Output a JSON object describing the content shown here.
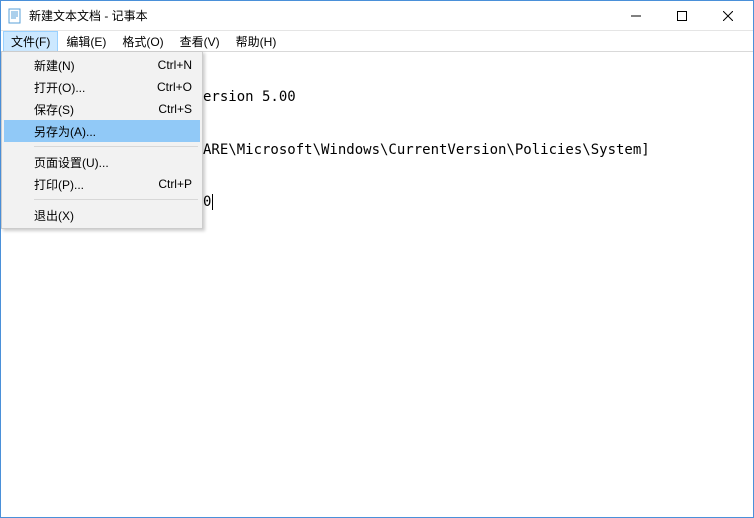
{
  "window": {
    "title": "新建文本文档 - 记事本"
  },
  "menubar": {
    "file": "文件(F)",
    "edit": "编辑(E)",
    "format": "格式(O)",
    "view": "查看(V)",
    "help": "帮助(H)"
  },
  "file_menu": {
    "new": {
      "label": "新建(N)",
      "shortcut": "Ctrl+N"
    },
    "open": {
      "label": "打开(O)...",
      "shortcut": "Ctrl+O"
    },
    "save": {
      "label": "保存(S)",
      "shortcut": "Ctrl+S"
    },
    "saveas": {
      "label": "另存为(A)...",
      "shortcut": ""
    },
    "pagesetup": {
      "label": "页面设置(U)...",
      "shortcut": ""
    },
    "print": {
      "label": "打印(P)...",
      "shortcut": "Ctrl+P"
    },
    "exit": {
      "label": "退出(X)",
      "shortcut": ""
    }
  },
  "editor": {
    "line1_visible": "ersion 5.00",
    "line2_visible": "ARE\\Microsoft\\Windows\\CurrentVersion\\Policies\\System]",
    "line3_visible": "0"
  }
}
